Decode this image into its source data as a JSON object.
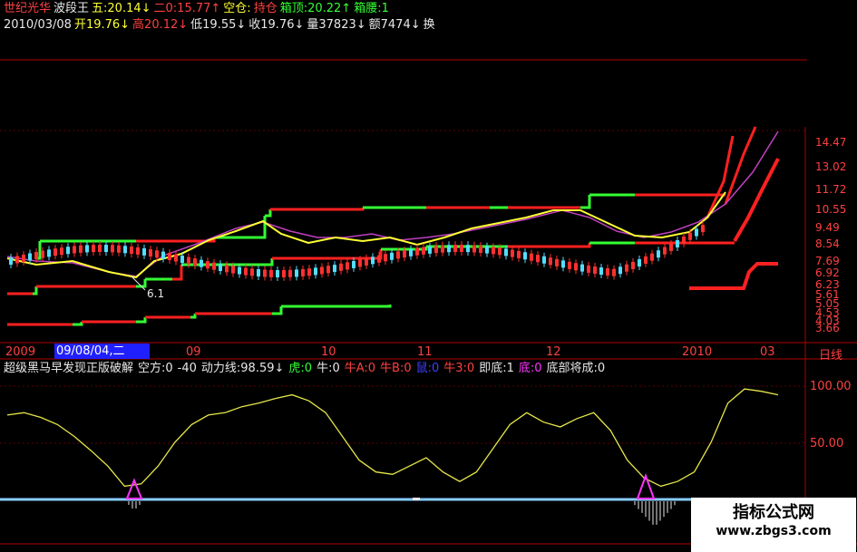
{
  "header": {
    "row1": [
      {
        "text": "世纪光华",
        "color": "#ff4040"
      },
      {
        "text": "波段王",
        "color": "#e8e8e8"
      },
      {
        "text": "五:20.14↓",
        "color": "#ffff33"
      },
      {
        "text": "二0:15.77↑",
        "color": "#ff4040"
      },
      {
        "text": "空仓:",
        "color": "#ffff33"
      },
      {
        "text": "持仓",
        "color": "#ff4040"
      },
      {
        "text": "箱顶:20.22↑",
        "color": "#33ff33"
      },
      {
        "text": "箱腰:1",
        "color": "#33ff33"
      }
    ],
    "row2": [
      {
        "text": "2010/03/08",
        "color": "#e8e8e8"
      },
      {
        "text": "开19.76↓",
        "color": "#ffff33"
      },
      {
        "text": "高20.12↓",
        "color": "#ff4040"
      },
      {
        "text": "低19.55↓",
        "color": "#e8e8e8"
      },
      {
        "text": "收19.76↓",
        "color": "#e8e8e8"
      },
      {
        "text": "量37823↓",
        "color": "#e8e8e8"
      },
      {
        "text": "额7474↓",
        "color": "#e8e8e8"
      },
      {
        "text": "换",
        "color": "#e8e8e8"
      }
    ]
  },
  "price_axis": [
    "14.47",
    "13.02",
    "11.72",
    "10.55",
    "9.49",
    "8.54",
    "7.69",
    "6.92",
    "6.23",
    "5.61",
    "5.05",
    "4.53",
    "4.03",
    "3.66"
  ],
  "date_axis": {
    "selected": "09/08/04,二",
    "labels": [
      {
        "text": "2009"
      },
      {
        "text": "09"
      },
      {
        "text": "10"
      },
      {
        "text": "11"
      },
      {
        "text": "12"
      },
      {
        "text": "2010"
      },
      {
        "text": "03"
      }
    ],
    "period": "日线"
  },
  "low_marker": "6.1",
  "indicator": {
    "items": [
      {
        "text": "超级黑马早发现正版破解",
        "color": "#e8e8e8"
      },
      {
        "text": "空方:0",
        "color": "#e8e8e8"
      },
      {
        "text": "-40",
        "color": "#e8e8e8"
      },
      {
        "text": "动力线:98.59↓",
        "color": "#e8e8e8"
      },
      {
        "text": "虎:0",
        "color": "#33ff33"
      },
      {
        "text": "牛:0",
        "color": "#e8e8e8"
      },
      {
        "text": "牛A:0",
        "color": "#ff4040"
      },
      {
        "text": "牛B:0",
        "color": "#ff4040"
      },
      {
        "text": "鼠:0",
        "color": "#4040ff"
      },
      {
        "text": "牛3:0",
        "color": "#ff4040"
      },
      {
        "text": "即底:1",
        "color": "#e8e8e8"
      },
      {
        "text": "底:0",
        "color": "#ff33ff"
      },
      {
        "text": "底部将成:0",
        "color": "#e8e8e8"
      }
    ],
    "axis": [
      "100.00",
      "50.00"
    ]
  },
  "watermark": {
    "line1": "指标公式网",
    "line2": "www.zbgs3.com"
  },
  "chart_data": {
    "type": "line",
    "title": "世纪光华 波段王",
    "series": [
      {
        "name": "动力线",
        "values": [
          78,
          80,
          76,
          70,
          60,
          48,
          35,
          18,
          20,
          35,
          55,
          70,
          78,
          80,
          85,
          88,
          92,
          95,
          90,
          80,
          60,
          40,
          30,
          28,
          35,
          42,
          30,
          22,
          30,
          50,
          70,
          80,
          72,
          68,
          75,
          80,
          65,
          40,
          25,
          18,
          22,
          30,
          55,
          88,
          100,
          98,
          95
        ]
      }
    ],
    "ylim": [
      0,
      110
    ]
  }
}
